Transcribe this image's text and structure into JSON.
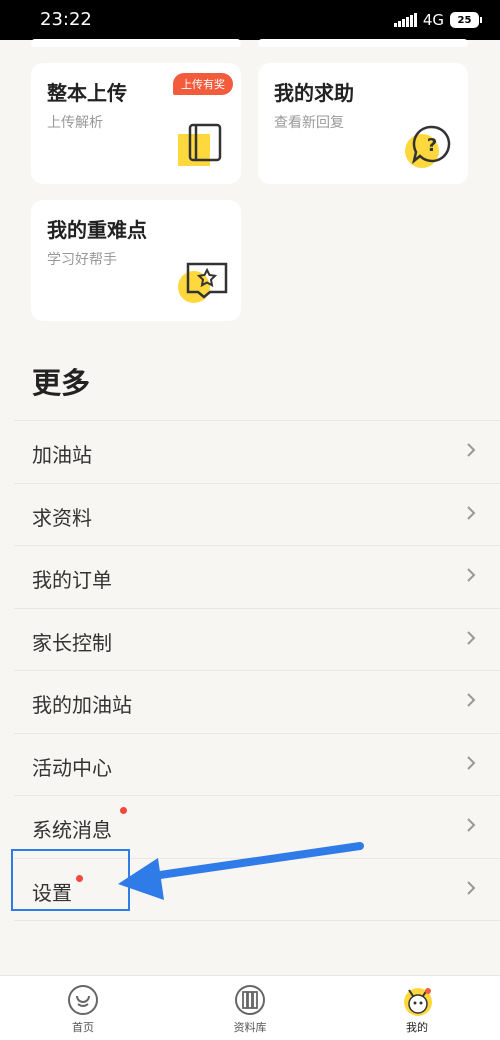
{
  "status_bar": {
    "time": "23:22",
    "network": "4G",
    "battery": "25"
  },
  "cards": [
    {
      "title": "整本上传",
      "subtitle": "上传解析",
      "badge": "上传有奖",
      "icon": "book-icon"
    },
    {
      "title": "我的求助",
      "subtitle": "查看新回复",
      "icon": "question-bubble-icon"
    },
    {
      "title": "我的重难点",
      "subtitle": "学习好帮手",
      "icon": "star-book-icon"
    }
  ],
  "section_title": "更多",
  "menu_items": [
    {
      "label": "加油站"
    },
    {
      "label": "求资料"
    },
    {
      "label": "我的订单"
    },
    {
      "label": "家长控制"
    },
    {
      "label": "我的加油站"
    },
    {
      "label": "活动中心"
    },
    {
      "label": "系统消息",
      "dot": true
    },
    {
      "label": "设置",
      "dot": true
    }
  ],
  "tab_bar": [
    {
      "label": "首页",
      "icon": "home-icon"
    },
    {
      "label": "资料库",
      "icon": "library-icon"
    },
    {
      "label": "我的",
      "icon": "profile-avatar-icon",
      "active": true
    }
  ],
  "colors": {
    "accent_yellow": "#ffd83d",
    "badge_red": "#f25b3c",
    "highlight_blue": "#2f7be8",
    "dot_red": "#f2493c"
  }
}
